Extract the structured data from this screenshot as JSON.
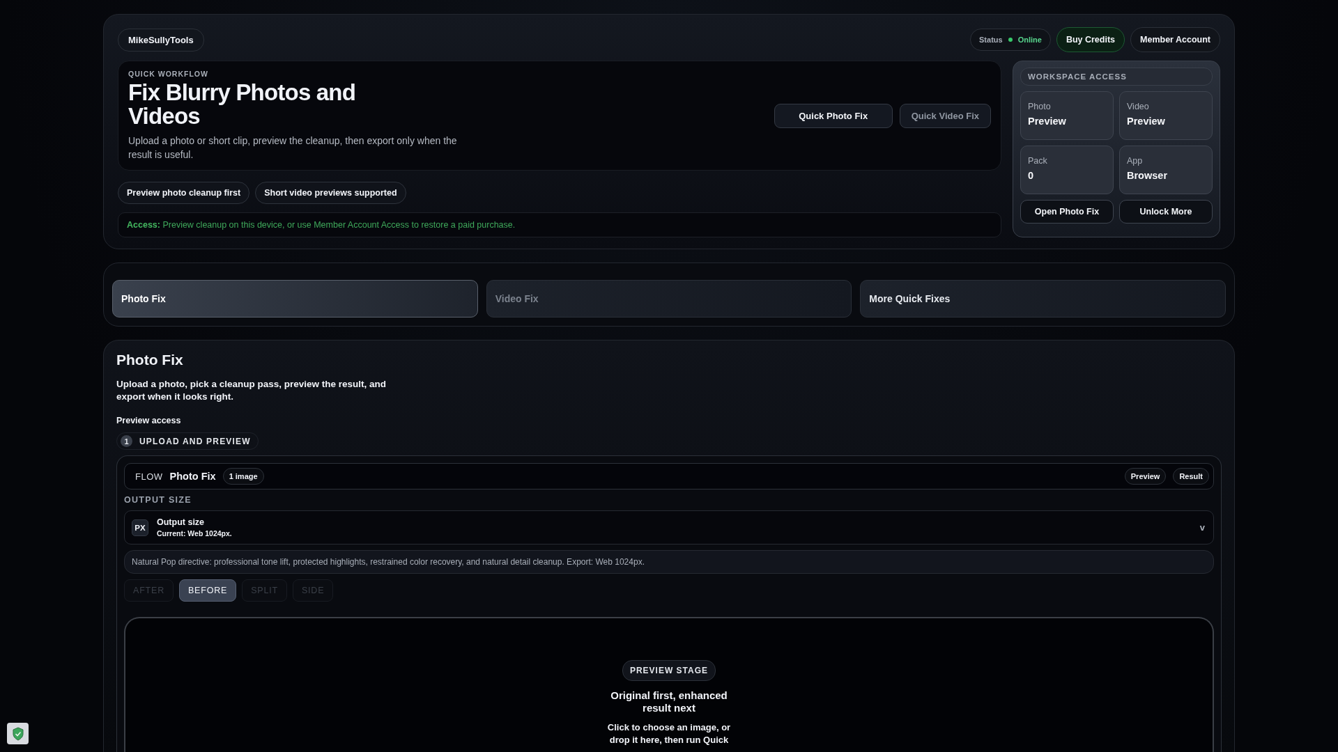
{
  "brand": "MikeSullyTools",
  "status": {
    "label": "Status",
    "value": "Online",
    "online": true
  },
  "header_buttons": [
    {
      "label": "Buy Credits",
      "kind": "accent"
    },
    {
      "label": "Member Account",
      "kind": "plain"
    }
  ],
  "hero": {
    "eyebrow": "QUICK WORKFLOW",
    "title": "Fix Blurry Photos and Videos",
    "description": "Upload a photo or short clip, preview the cleanup, then export only when the result is useful.",
    "actions": [
      {
        "label": "Quick Photo Fix",
        "disabled": false
      },
      {
        "label": "Quick Video Fix",
        "disabled": true
      }
    ]
  },
  "chips": [
    "Preview photo cleanup first",
    "Short video previews supported"
  ],
  "access_note": "**Access:** Preview cleanup on this device, or use Member Account Access to restore a paid purchase.",
  "workspace": {
    "title": "WORKSPACE ACCESS",
    "stats": [
      {
        "label": "Photo",
        "value": "Preview"
      },
      {
        "label": "Video",
        "value": "Preview"
      },
      {
        "label": "Pack",
        "value": "0"
      },
      {
        "label": "App",
        "value": "Browser"
      }
    ],
    "buttons": [
      "Open Photo Fix",
      "Unlock More"
    ]
  },
  "tabs": [
    {
      "label": "Photo Fix",
      "selected": true,
      "disabled": false
    },
    {
      "label": "Video Fix",
      "selected": false,
      "disabled": true
    },
    {
      "label": "More Quick Fixes",
      "selected": false,
      "disabled": false
    }
  ],
  "section": {
    "title": "Photo Fix",
    "description": "Upload a photo, pick a cleanup pass, preview the result, and export when it looks right.",
    "access_label": "Preview access",
    "step": {
      "number": "1",
      "label": "UPLOAD AND PREVIEW"
    },
    "flow": {
      "prefix": "FLOW",
      "name": "Photo Fix",
      "count": "1 image",
      "actions": [
        "Preview",
        "Result"
      ]
    },
    "output_heading": "OUTPUT SIZE",
    "output_select": {
      "badge": "PX",
      "title": "Output size",
      "current": "Current: Web 1024px.",
      "caret": "v"
    },
    "directive": "Natural Pop directive: professional tone lift, protected highlights, restrained color recovery, and natural detail cleanup. Export: Web 1024px.",
    "view_modes": [
      {
        "label": "AFTER",
        "selected": false
      },
      {
        "label": "BEFORE",
        "selected": true
      },
      {
        "label": "SPLIT",
        "selected": false
      },
      {
        "label": "SIDE",
        "selected": false
      }
    ],
    "stage": {
      "badge": "PREVIEW STAGE",
      "heading": "Original first, enhanced result next",
      "hint": "Click to choose an image, or drop it here, then run Quick"
    }
  }
}
